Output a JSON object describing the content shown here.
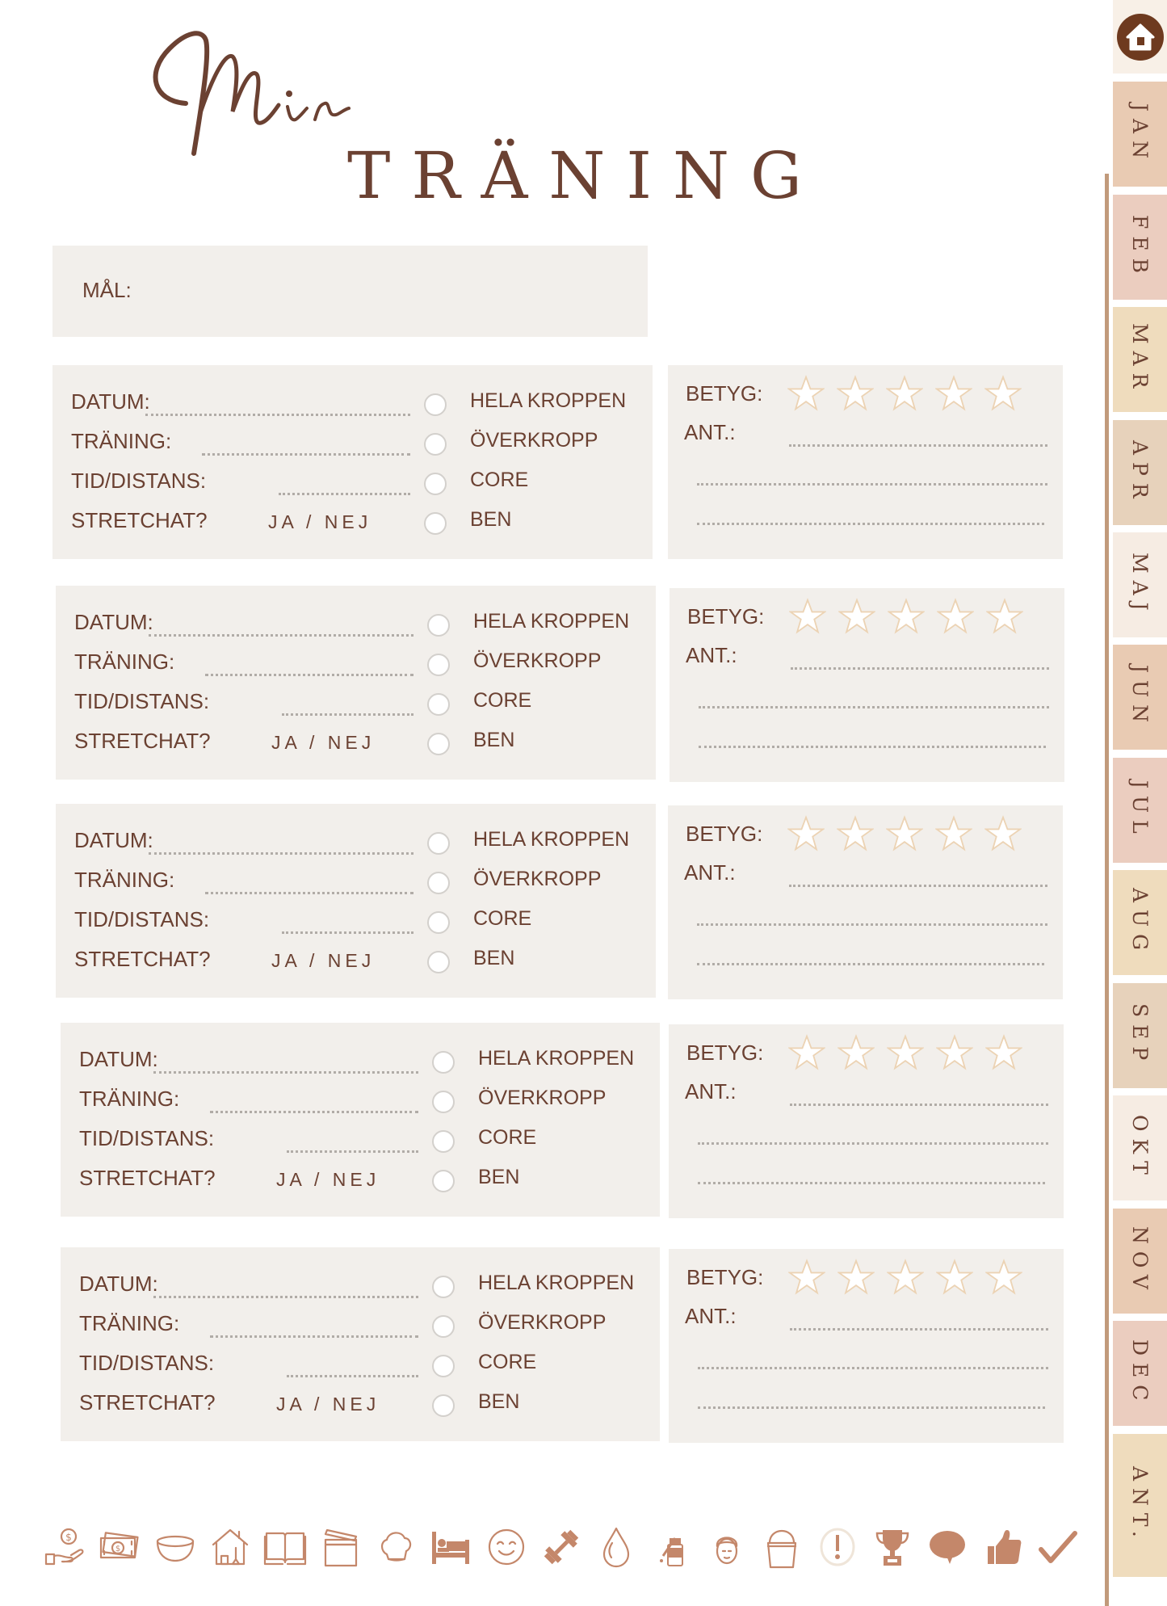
{
  "header": {
    "script_title": "Min",
    "title": "TRÄNING"
  },
  "goal": {
    "label": "MÅL:"
  },
  "entry_labels": {
    "date": "DATUM:",
    "training": "TRÄNING:",
    "time_distance": "TID/DISTANS:",
    "stretched": "STRETCHAT?",
    "yes_no": "JA / NEJ",
    "rating": "BETYG:",
    "notes": "ANT.:"
  },
  "body_options": [
    "HELA KROPPEN",
    "ÖVERKROPP",
    "CORE",
    "BEN"
  ],
  "entries": [
    {
      "rating_max": 5,
      "rating": 0
    },
    {
      "rating_max": 5,
      "rating": 0
    },
    {
      "rating_max": 5,
      "rating": 0
    },
    {
      "rating_max": 5,
      "rating": 0
    },
    {
      "rating_max": 5,
      "rating": 0
    }
  ],
  "side_tabs": {
    "home_icon": "home-icon",
    "months": [
      "JAN",
      "FEB",
      "MAR",
      "APR",
      "MAJ",
      "JUN",
      "JUL",
      "AUG",
      "SEP",
      "OKT",
      "NOV",
      "DEC",
      "ANT."
    ],
    "colors": [
      "#e9cbb3",
      "#ebcdbf",
      "#efdcbd",
      "#e7d2bb",
      "#f6ece3",
      "#e9cbb3",
      "#ebcdbf",
      "#efdcbd",
      "#e7d2bb",
      "#f6ece3",
      "#e9cbb3",
      "#ebcdbf",
      "#efdcbd"
    ],
    "home_bg": "#f8f0e7"
  },
  "bottom_icons": [
    "money-hand-icon",
    "cash-icon",
    "bowl-icon",
    "house-cleaning-icon",
    "book-icon",
    "clapperboard-icon",
    "chef-hat-icon",
    "bed-icon",
    "smiley-icon",
    "dumbbell-icon",
    "water-drop-icon",
    "dropper-bottle-icon",
    "face-towel-icon",
    "bucket-icon",
    "exclamation-icon",
    "trophy-icon",
    "speech-bubble-icon",
    "thumbs-up-icon",
    "checkmark-icon"
  ],
  "colors": {
    "text": "#6b4132",
    "card_bg": "#f2efeb",
    "star_stroke": "#ecd3b4",
    "icon": "#c4876a",
    "home": "#6e3a1f",
    "spine": "#c19a7b"
  }
}
